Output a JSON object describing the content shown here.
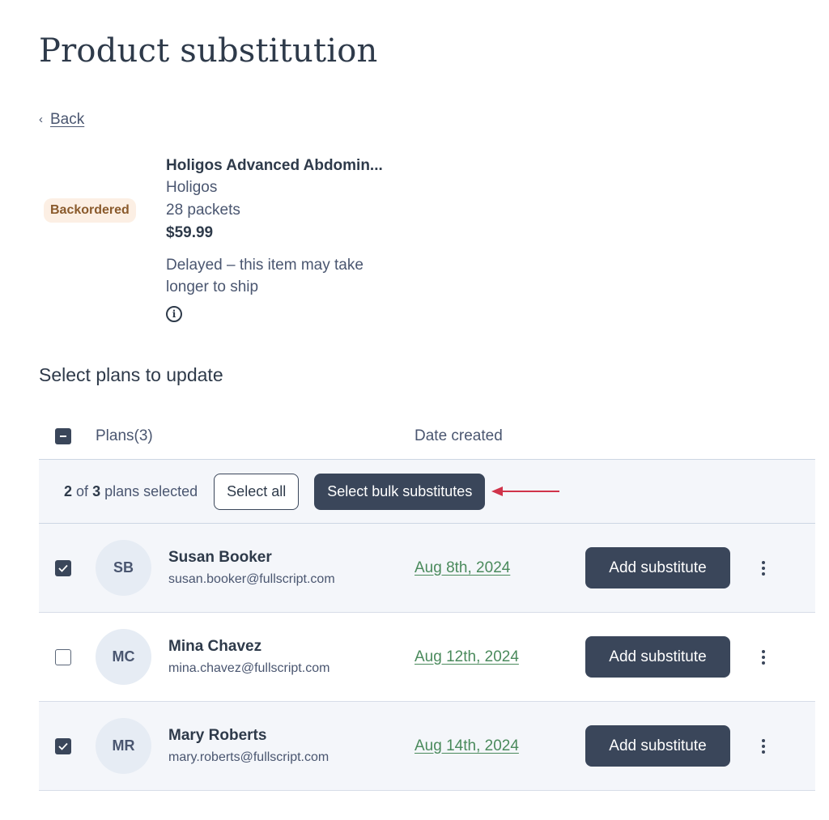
{
  "page": {
    "title": "Product substitution",
    "back_label": "Back"
  },
  "product": {
    "status_badge": "Backordered",
    "name": "Holigos Advanced Abdomin...",
    "brand": "Holigos",
    "size": "28 packets",
    "price": "$59.99",
    "delay_message": "Delayed – this item may take longer to ship",
    "info_icon": "info-circle-icon"
  },
  "plans_section": {
    "title": "Select plans to update",
    "header": {
      "plans_label": "Plans(3)",
      "date_label": "Date created",
      "select_state": "indeterminate"
    },
    "bulk_bar": {
      "selected_count": "2",
      "of_label": "of",
      "total_count": "3",
      "suffix_label": "plans selected",
      "select_all_label": "Select all",
      "bulk_button_label": "Select bulk substitutes",
      "annotation_arrow_color": "#d0334a"
    },
    "rows": [
      {
        "checked": true,
        "initials": "SB",
        "name": "Susan Booker",
        "email": "susan.booker@fullscript.com",
        "date": "Aug 8th, 2024",
        "action_label": "Add substitute"
      },
      {
        "checked": false,
        "initials": "MC",
        "name": "Mina Chavez",
        "email": "mina.chavez@fullscript.com",
        "date": "Aug 12th, 2024",
        "action_label": "Add substitute"
      },
      {
        "checked": true,
        "initials": "MR",
        "name": "Mary Roberts",
        "email": "mary.roberts@fullscript.com",
        "date": "Aug 14th, 2024",
        "action_label": "Add substitute"
      }
    ]
  },
  "colors": {
    "primary_dark": "#3a465a",
    "link_green": "#4a8a5c",
    "badge_bg": "#fcefe4",
    "badge_text": "#8a5a2c",
    "row_shade": "#f4f6fa"
  }
}
